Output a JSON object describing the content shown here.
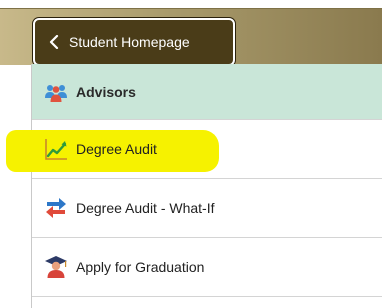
{
  "back_button": {
    "label": "Student Homepage"
  },
  "nav": {
    "header": {
      "label": "Advisors",
      "icon": "advisors-icon"
    },
    "items": [
      {
        "label": "Degree Audit",
        "icon": "chart-line-icon",
        "highlighted": true
      },
      {
        "label": "Degree Audit - What-If",
        "icon": "swap-arrows-icon"
      },
      {
        "label": "Apply for Graduation",
        "icon": "graduate-icon"
      }
    ]
  },
  "colors": {
    "banner": "#a89a6b",
    "back_button_bg": "#4a3c18",
    "header_bg": "#c9e6d8",
    "highlight": "#f6f200"
  }
}
